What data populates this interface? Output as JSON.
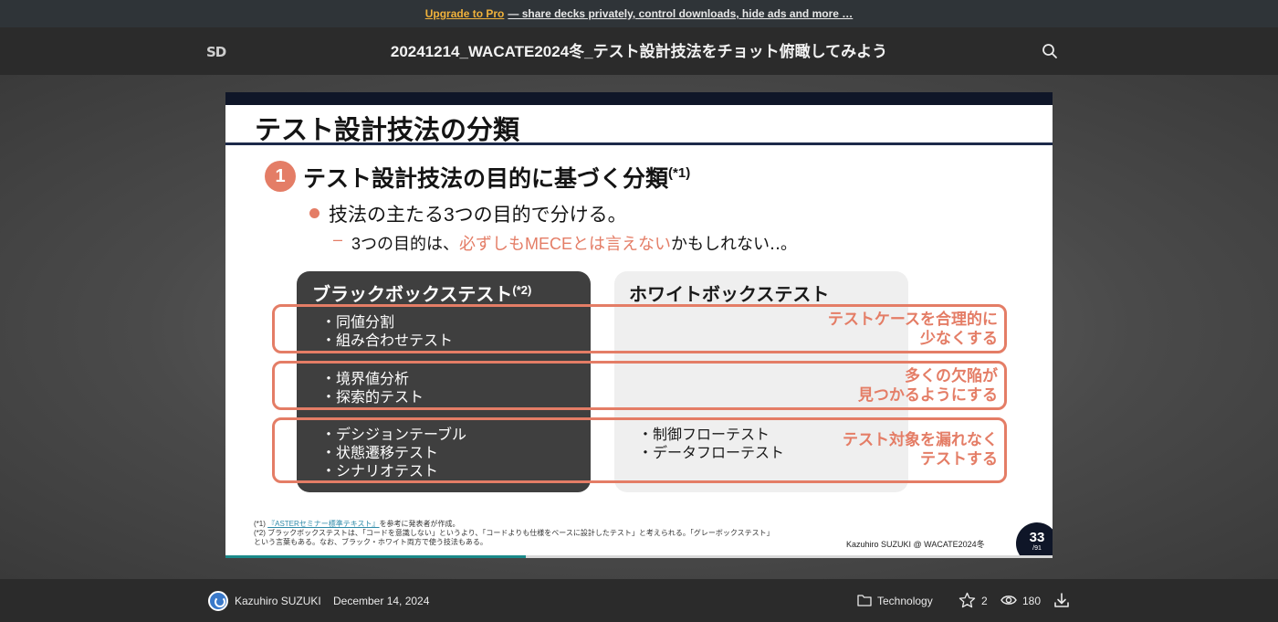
{
  "promo": {
    "link_label": "Upgrade to Pro",
    "rest": "— share decks privately, control downloads, hide ads and more …"
  },
  "header": {
    "logo": "SD",
    "title": "20241214_WACATE2024冬_テスト設計技法をチョット俯瞰してみよう"
  },
  "slide": {
    "title": "テスト設計技法の分類",
    "section_number": "1",
    "heading": "テスト設計技法の目的に基づく分類",
    "heading_note": "(*1)",
    "bullet": "技法の主たる3つの目的で分ける。",
    "sub_prefix": "3つの目的は、",
    "sub_highlight": "必ずしもMECEとは言えない",
    "sub_suffix": "かもしれない‥。",
    "blackbox": {
      "title": "ブラックボックステスト",
      "note": "(*2)"
    },
    "whitebox": {
      "title": "ホワイトボックステスト"
    },
    "rows": [
      {
        "black_items": [
          "・同値分割",
          "・組み合わせテスト"
        ],
        "white_items": [],
        "goal": [
          "テストケースを合理的に",
          "少なくする"
        ]
      },
      {
        "black_items": [
          "・境界値分析",
          "・探索的テスト"
        ],
        "white_items": [],
        "goal": [
          "多くの欠陥が",
          "見つかるようにする"
        ]
      },
      {
        "black_items": [
          "・デシジョンテーブル",
          "・状態遷移テスト",
          "・シナリオテスト"
        ],
        "white_items": [
          "・制御フローテスト",
          "・データフローテスト"
        ],
        "goal": [
          "テスト対象を漏れなく",
          "テストする"
        ]
      }
    ],
    "footnote1_prefix": "(*1) ",
    "footnote1_link": "『ASTERセミナー標準テキスト』",
    "footnote1_suffix": "を参考に発表者が作成。",
    "footnote2": "(*2) ブラックボックステストは、「コードを意識しない」というより、「コードよりも仕様をベースに設計したテスト」と考えられる。「グレーボックステスト」",
    "footnote3": "という言葉もある。なお、ブラック・ホワイト両方で使う技法もある。",
    "credit": "Kazuhiro SUZUKI @ WACATE2024冬",
    "page_number": "33",
    "page_total": "/91",
    "progress": 0.3626
  },
  "footer": {
    "author": "Kazuhiro SUZUKI",
    "date": "December 14, 2024",
    "category": "Technology",
    "stars": "2",
    "views": "180"
  },
  "colors": {
    "accent": "#e47d66",
    "promo_link": "#f0b23b",
    "navy": "#0f1628"
  }
}
